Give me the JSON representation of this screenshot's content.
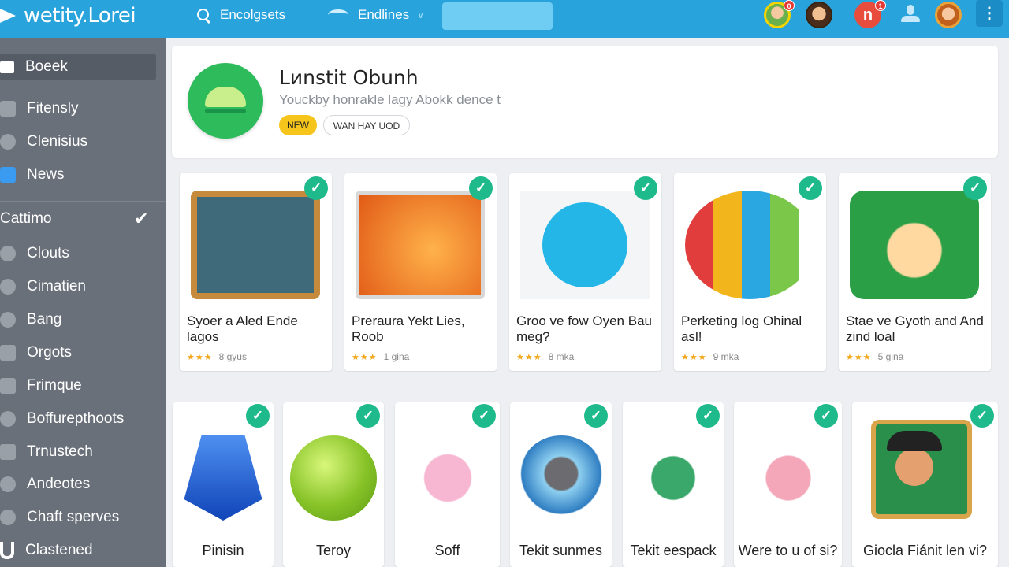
{
  "topbar": {
    "brand": "wetity.Lorei",
    "nav": [
      {
        "label": "Encolgsets",
        "icon": "search-icon"
      },
      {
        "label": "Endlines",
        "icon": "wave-icon"
      }
    ],
    "search": {
      "value": "",
      "placeholder": ""
    },
    "badges": [
      "0",
      "1"
    ],
    "avatar_letter": "n",
    "kebab": "⋮"
  },
  "sidebar": {
    "items": [
      {
        "label": "Boeek",
        "icon": "home-icon"
      },
      {
        "label": "Fitensly",
        "icon": "chat-icon"
      },
      {
        "label": "Clenisius",
        "icon": "info-icon"
      },
      {
        "label": "News",
        "icon": "lock-icon"
      },
      {
        "label": "Cattimo",
        "icon": "check-icon"
      },
      {
        "label": "Clouts",
        "icon": "cloud-icon"
      },
      {
        "label": "Cimatien",
        "icon": "globe-icon"
      },
      {
        "label": "Bang",
        "icon": "users-icon"
      },
      {
        "label": "Orgots",
        "icon": "square-icon"
      },
      {
        "label": "Frimque",
        "icon": "monitor-icon"
      },
      {
        "label": "Boffurepthoots",
        "icon": "person-icon"
      },
      {
        "label": "Trnustech",
        "icon": "list-icon"
      },
      {
        "label": "Andeotes",
        "icon": "tag-icon"
      },
      {
        "label": "Chaft sperves",
        "icon": "gear-icon"
      },
      {
        "label": "Clastened",
        "icon": "u-icon"
      }
    ],
    "check": "✔"
  },
  "feature": {
    "title": "Lиnstit Obunh",
    "subtitle": "Youckby honrakle lagy Abokk dence t",
    "tag_new": "NEW",
    "tag_way": "WAN HAY UOD"
  },
  "apps_row1": [
    {
      "title": "Syoer a Aled Ende lagos",
      "rating": "★★★",
      "meta": "8 gyus",
      "thumb": "wood-frame"
    },
    {
      "title": "Preraura Yekt Lies, Roob",
      "rating": "★★★",
      "meta": "1 gina",
      "thumb": "orange-creature"
    },
    {
      "title": "Groo ve fow Oyen Bau meg?",
      "rating": "★★★",
      "meta": "8 mka",
      "thumb": "chat-bubble"
    },
    {
      "title": "Perketing log Ohinal asl!",
      "rating": "★★★",
      "meta": "9 mka",
      "thumb": "color-bars"
    },
    {
      "title": "Stae ve Gyoth and And zind loal",
      "rating": "★★★",
      "meta": "5 gina",
      "thumb": "girl-character"
    }
  ],
  "apps_row2": [
    {
      "title": "Pinisin",
      "thumb": "crystal"
    },
    {
      "title": "Teroy",
      "thumb": "green-ball"
    },
    {
      "title": "Soff",
      "thumb": "pink-pig"
    },
    {
      "title": "Tekit sunmes",
      "thumb": "round-scene"
    },
    {
      "title": "Tekit eespack",
      "thumb": "green-mouse"
    },
    {
      "title": "Were to u of si?",
      "thumb": "pig-balloon"
    },
    {
      "title": "Giocla Fiánit len vi?",
      "thumb": "man-hat"
    }
  ],
  "checkmark": "✓"
}
